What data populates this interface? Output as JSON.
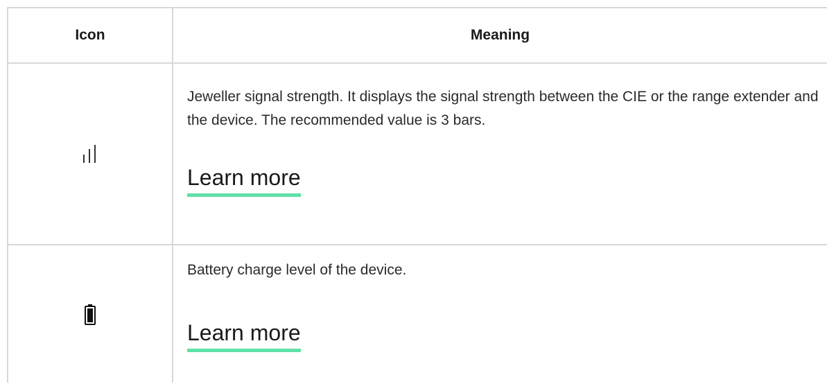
{
  "table": {
    "headers": {
      "icon": "Icon",
      "meaning": "Meaning"
    },
    "rows": [
      {
        "icon": "signal-strength-icon",
        "description": "Jeweller signal strength. It displays the signal strength between the CIE or the range extender and the device. The recommended value is 3 bars.",
        "link": "Learn more",
        "signal_bars_shown": 3
      },
      {
        "icon": "battery-icon",
        "description": "Battery charge level of the device.",
        "link": "Learn more"
      }
    ]
  },
  "colors": {
    "link_underline": "#5ee0a6",
    "border": "#d8d8d8",
    "text": "#222222"
  }
}
